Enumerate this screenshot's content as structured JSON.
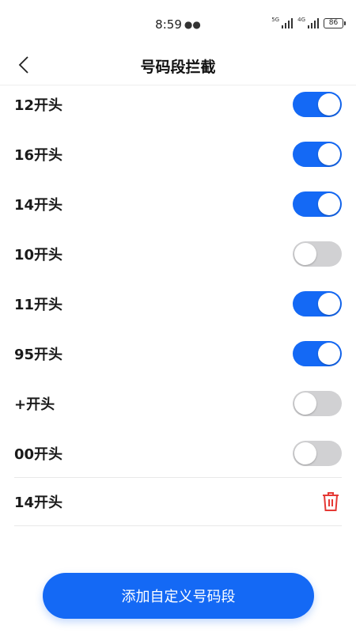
{
  "status": {
    "time": "8:59",
    "sig1": "5G",
    "sig2": "4G",
    "battery": "86"
  },
  "header": {
    "title": "号码段拦截"
  },
  "prefixes": [
    {
      "label": "12开头",
      "enabled": true
    },
    {
      "label": "16开头",
      "enabled": true
    },
    {
      "label": "14开头",
      "enabled": true
    },
    {
      "label": "10开头",
      "enabled": false
    },
    {
      "label": "11开头",
      "enabled": true
    },
    {
      "label": "95开头",
      "enabled": true
    },
    {
      "label": "+开头",
      "enabled": false
    },
    {
      "label": "00开头",
      "enabled": false
    }
  ],
  "custom": [
    {
      "label": "14开头"
    }
  ],
  "add_button": {
    "label": "添加自定义号码段"
  },
  "colors": {
    "accent": "#1469f5",
    "toggle_off": "#d1d1d3",
    "delete": "#e53935"
  }
}
